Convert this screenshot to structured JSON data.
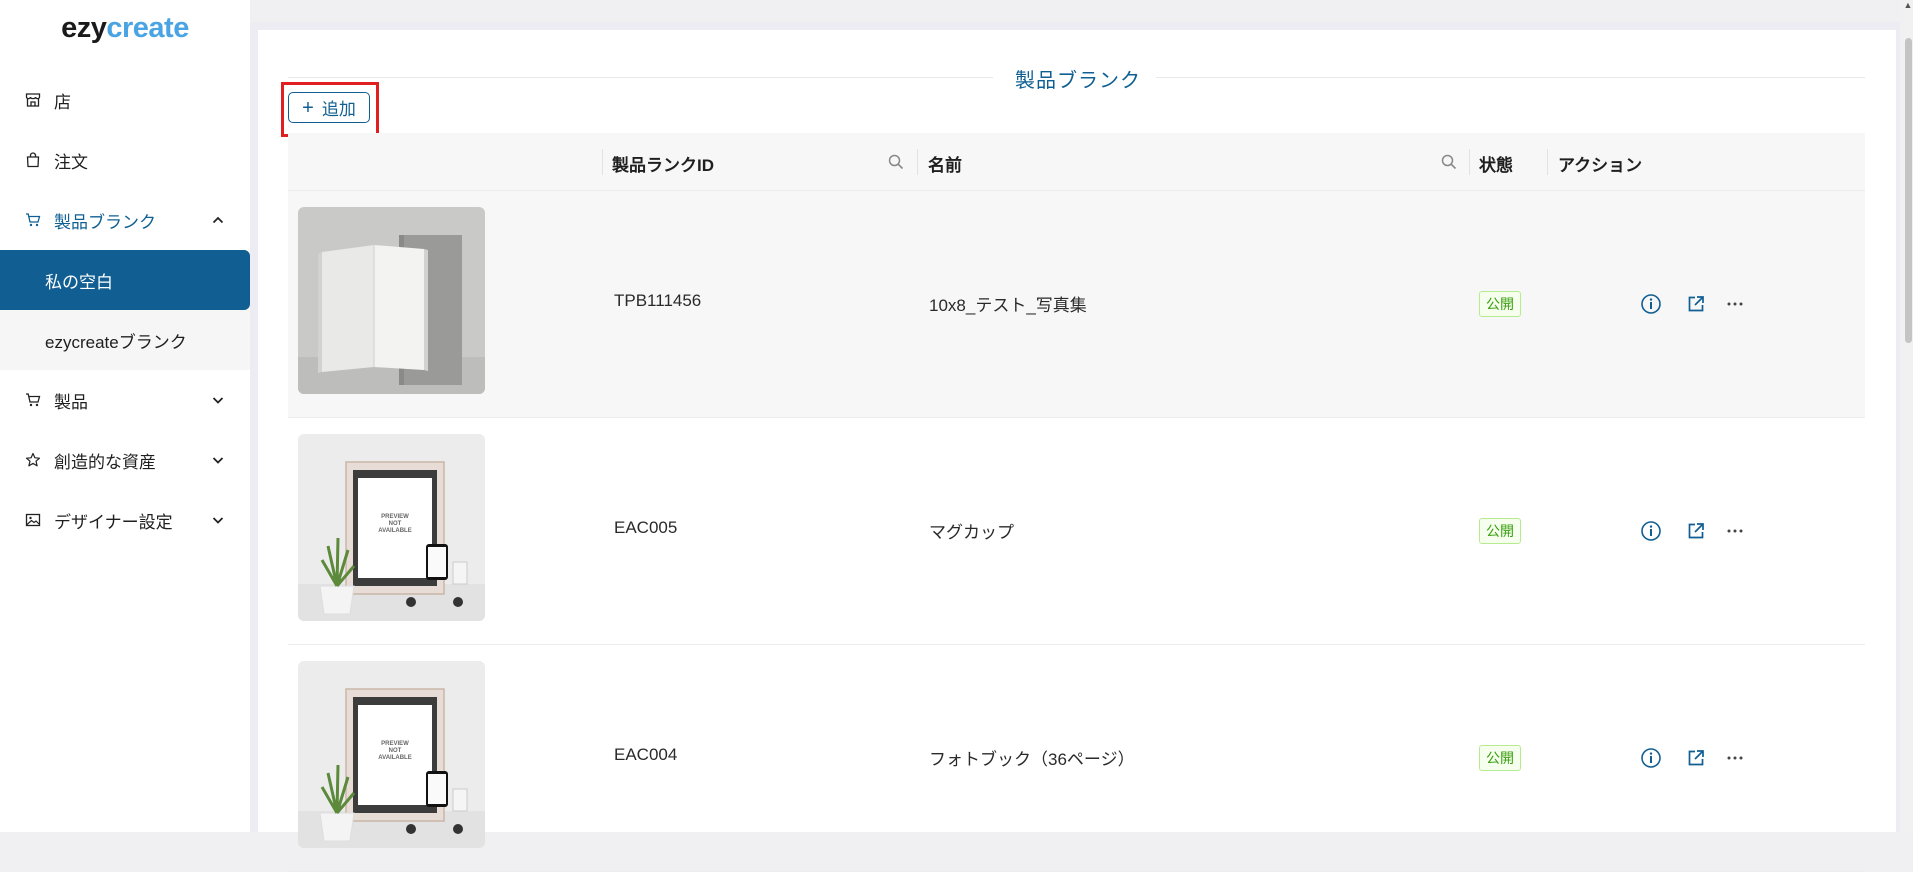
{
  "app": {
    "logo_part1": "ezy",
    "logo_part2": "create"
  },
  "sidebar": {
    "items": [
      {
        "label": "店",
        "icon": "store-icon"
      },
      {
        "label": "注文",
        "icon": "shopping-bag-icon"
      },
      {
        "label": "製品ブランク",
        "icon": "cart-icon",
        "expanded": true
      },
      {
        "label": "製品",
        "icon": "cart-icon"
      },
      {
        "label": "創造的な資産",
        "icon": "star-icon"
      },
      {
        "label": "デザイナー設定",
        "icon": "image-icon"
      }
    ],
    "subitems": [
      {
        "label": "私の空白",
        "selected": true
      },
      {
        "label": "ezycreateブランク",
        "selected": false
      }
    ]
  },
  "page": {
    "title": "製品ブランク",
    "add_label": "追加"
  },
  "table": {
    "headers": {
      "id": "製品ランクID",
      "name": "名前",
      "status": "状態",
      "actions": "アクション"
    },
    "rows": [
      {
        "id": "TPB111456",
        "name": "10x8_テスト_写真集",
        "status": "公開",
        "thumb": "photobook"
      },
      {
        "id": "EAC005",
        "name": "マグカップ",
        "status": "公開",
        "thumb": "preview"
      },
      {
        "id": "EAC004",
        "name": "フォトブック（36ページ）",
        "status": "公開",
        "thumb": "preview"
      }
    ],
    "preview_text": [
      "PREVIEW",
      "NOT",
      "AVAILABLE"
    ]
  },
  "colors": {
    "primary": "#115f92",
    "accent": "#4aa3e3",
    "status_green": "#389e0d",
    "highlight_red": "#e02020"
  }
}
